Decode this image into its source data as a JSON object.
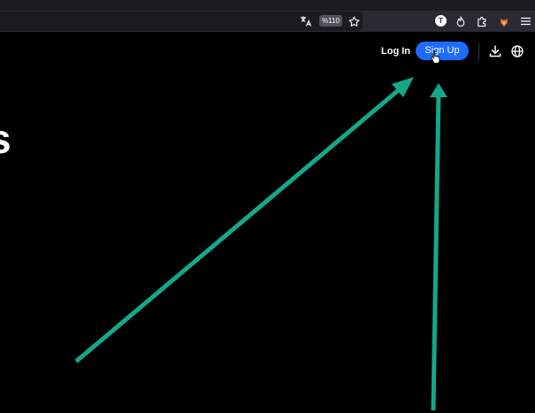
{
  "browser": {
    "zoom_level": "%110",
    "extension_t_label": "T",
    "icons": [
      "translate-icon",
      "star-icon",
      "extension-t-icon",
      "fire-icon",
      "extensions-puzzle-icon",
      "fox-icon",
      "menu-icon"
    ]
  },
  "header": {
    "login_label": "Log In",
    "signup_label": "Sign Up",
    "icons": [
      "download-icon",
      "globe-icon"
    ]
  },
  "hero": {
    "fragment": "s"
  },
  "colors": {
    "page_background": "#000000",
    "primary_button": "#1e6bff",
    "annotation_arrow": "#14a88a",
    "toolbar": "#2b2a33"
  }
}
